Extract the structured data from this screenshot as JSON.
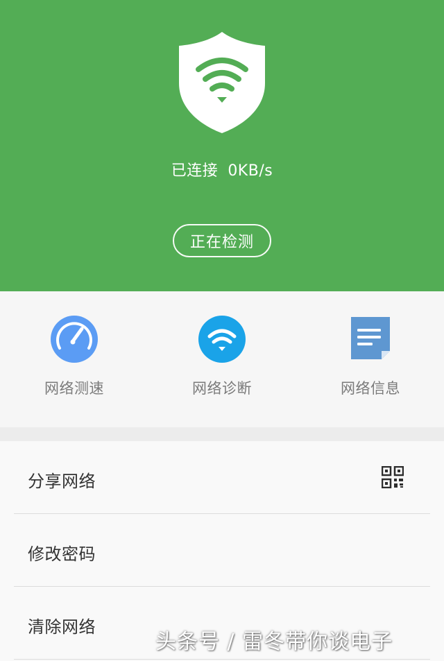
{
  "header": {
    "status_label": "已连接",
    "speed": "0KB/s",
    "detect_button": "正在检测"
  },
  "tools": [
    {
      "label": "网络测速",
      "icon": "speedometer-icon"
    },
    {
      "label": "网络诊断",
      "icon": "wifi-icon"
    },
    {
      "label": "网络信息",
      "icon": "document-icon"
    }
  ],
  "menu": [
    {
      "label": "分享网络",
      "icon": "qr-code-icon"
    },
    {
      "label": "修改密码"
    },
    {
      "label": "清除网络"
    }
  ],
  "watermark": "头条号 / 雷冬带你谈电子",
  "colors": {
    "brand_green": "#53ad55",
    "speed_blue": "#5b9cf4",
    "diag_blue": "#1aa3e8",
    "info_blue": "#5e97d1"
  }
}
